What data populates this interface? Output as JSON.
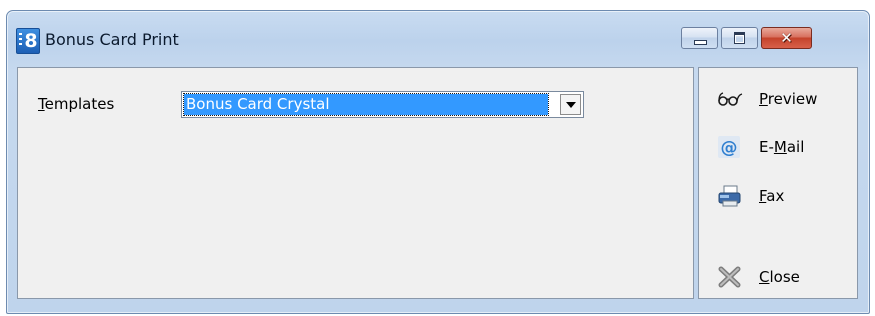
{
  "window": {
    "title": "Bonus Card Print",
    "app_icon_glyph": "8",
    "close_glyph": "✕"
  },
  "form": {
    "templates_label_prefix": "T",
    "templates_label_rest": "emplates",
    "templates_value": "Bonus Card Crystal"
  },
  "actions": {
    "preview": {
      "icon": "glasses-icon",
      "icon_text": "6o^",
      "prefix": "",
      "accel": "P",
      "rest": "review"
    },
    "email": {
      "icon": "at-sign-icon",
      "icon_text": "@",
      "prefix": "E-",
      "accel": "M",
      "rest": "ail"
    },
    "fax": {
      "icon": "fax-icon",
      "prefix": "",
      "accel": "F",
      "rest": "ax"
    },
    "close": {
      "icon": "close-x-icon",
      "prefix": "",
      "accel": "C",
      "rest": "lose"
    }
  },
  "colors": {
    "selection": "#3399ff",
    "titlebar": "#c6d9ef",
    "close_button": "#c4432b",
    "panel": "#f0f0f0"
  }
}
